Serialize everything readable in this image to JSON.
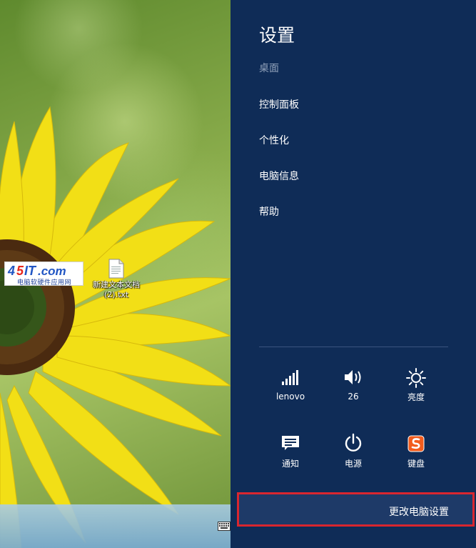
{
  "desktop": {
    "logo": {
      "main": "45IT.com",
      "sub": "电脑软硬件应用网"
    },
    "file": {
      "label": "新建文本文档 (2).txt"
    }
  },
  "settings": {
    "title": "设置",
    "subtitle": "桌面",
    "menu": [
      "控制面板",
      "个性化",
      "电脑信息",
      "帮助"
    ],
    "tiles": [
      {
        "label": "lenovo",
        "icon": "wifi-signal-icon"
      },
      {
        "label": "26",
        "icon": "volume-icon"
      },
      {
        "label": "亮度",
        "icon": "brightness-icon"
      },
      {
        "label": "通知",
        "icon": "notifications-icon"
      },
      {
        "label": "电源",
        "icon": "power-icon"
      },
      {
        "label": "键盘",
        "icon": "sogou-input-icon"
      }
    ],
    "change_pc_settings": "更改电脑设置"
  },
  "colors": {
    "pane_bg": "#0f2c57",
    "highlight_border": "#d9262f",
    "sunflower_yellow": "#f2df16"
  }
}
